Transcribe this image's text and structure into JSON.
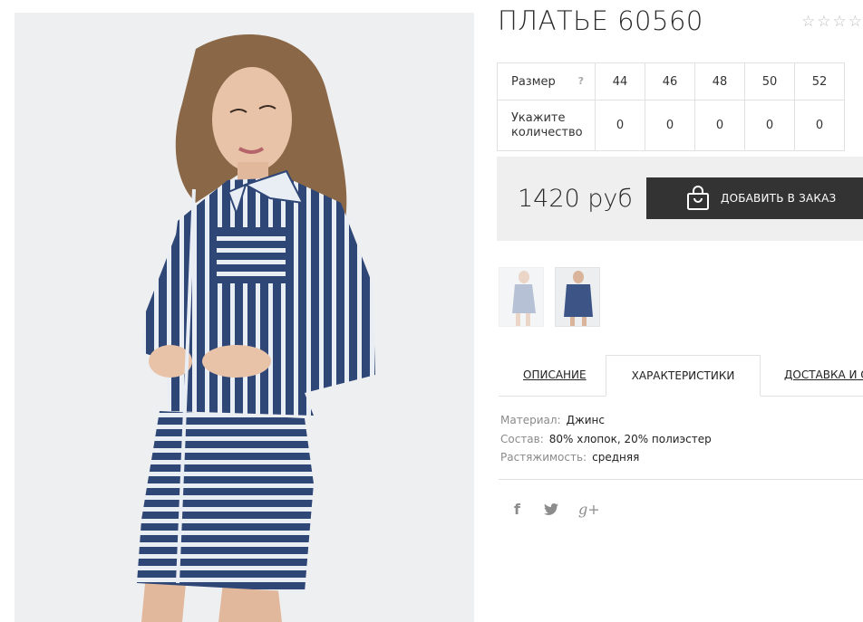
{
  "product": {
    "title": "ПЛАТЬЕ 60560",
    "rating_stars": [
      "☆",
      "☆",
      "☆",
      "☆"
    ],
    "rating_value": 0
  },
  "size_table": {
    "size_label": "Размер",
    "help_mark": "?",
    "sizes": [
      "44",
      "46",
      "48",
      "50",
      "52"
    ],
    "qty_label_line1": "Укажите",
    "qty_label_line2": "количество",
    "quantities": [
      "0",
      "0",
      "0",
      "0",
      "0"
    ]
  },
  "order": {
    "price": "1420 руб",
    "button_label": "ДОБАВИТЬ В ЗАКАЗ"
  },
  "tabs": [
    {
      "label": "ОПИСАНИЕ"
    },
    {
      "label": "ХАРАКТЕРИСТИКИ",
      "active": true
    },
    {
      "label": "ДОСТАВКА И О"
    }
  ],
  "specs": [
    {
      "key": "Материал:",
      "value": "Джинс"
    },
    {
      "key": "Состав:",
      "value": "80% хлопок, 20% полиэстер"
    },
    {
      "key": "Растяжимость:",
      "value": "средняя"
    }
  ],
  "social": {
    "facebook": "f",
    "twitter": "🐦",
    "google": "g+"
  },
  "colors": {
    "dress_navy": "#2f4777",
    "button_bg": "#333333",
    "price_box_bg": "#efefef",
    "star": "#bdbdbd"
  }
}
